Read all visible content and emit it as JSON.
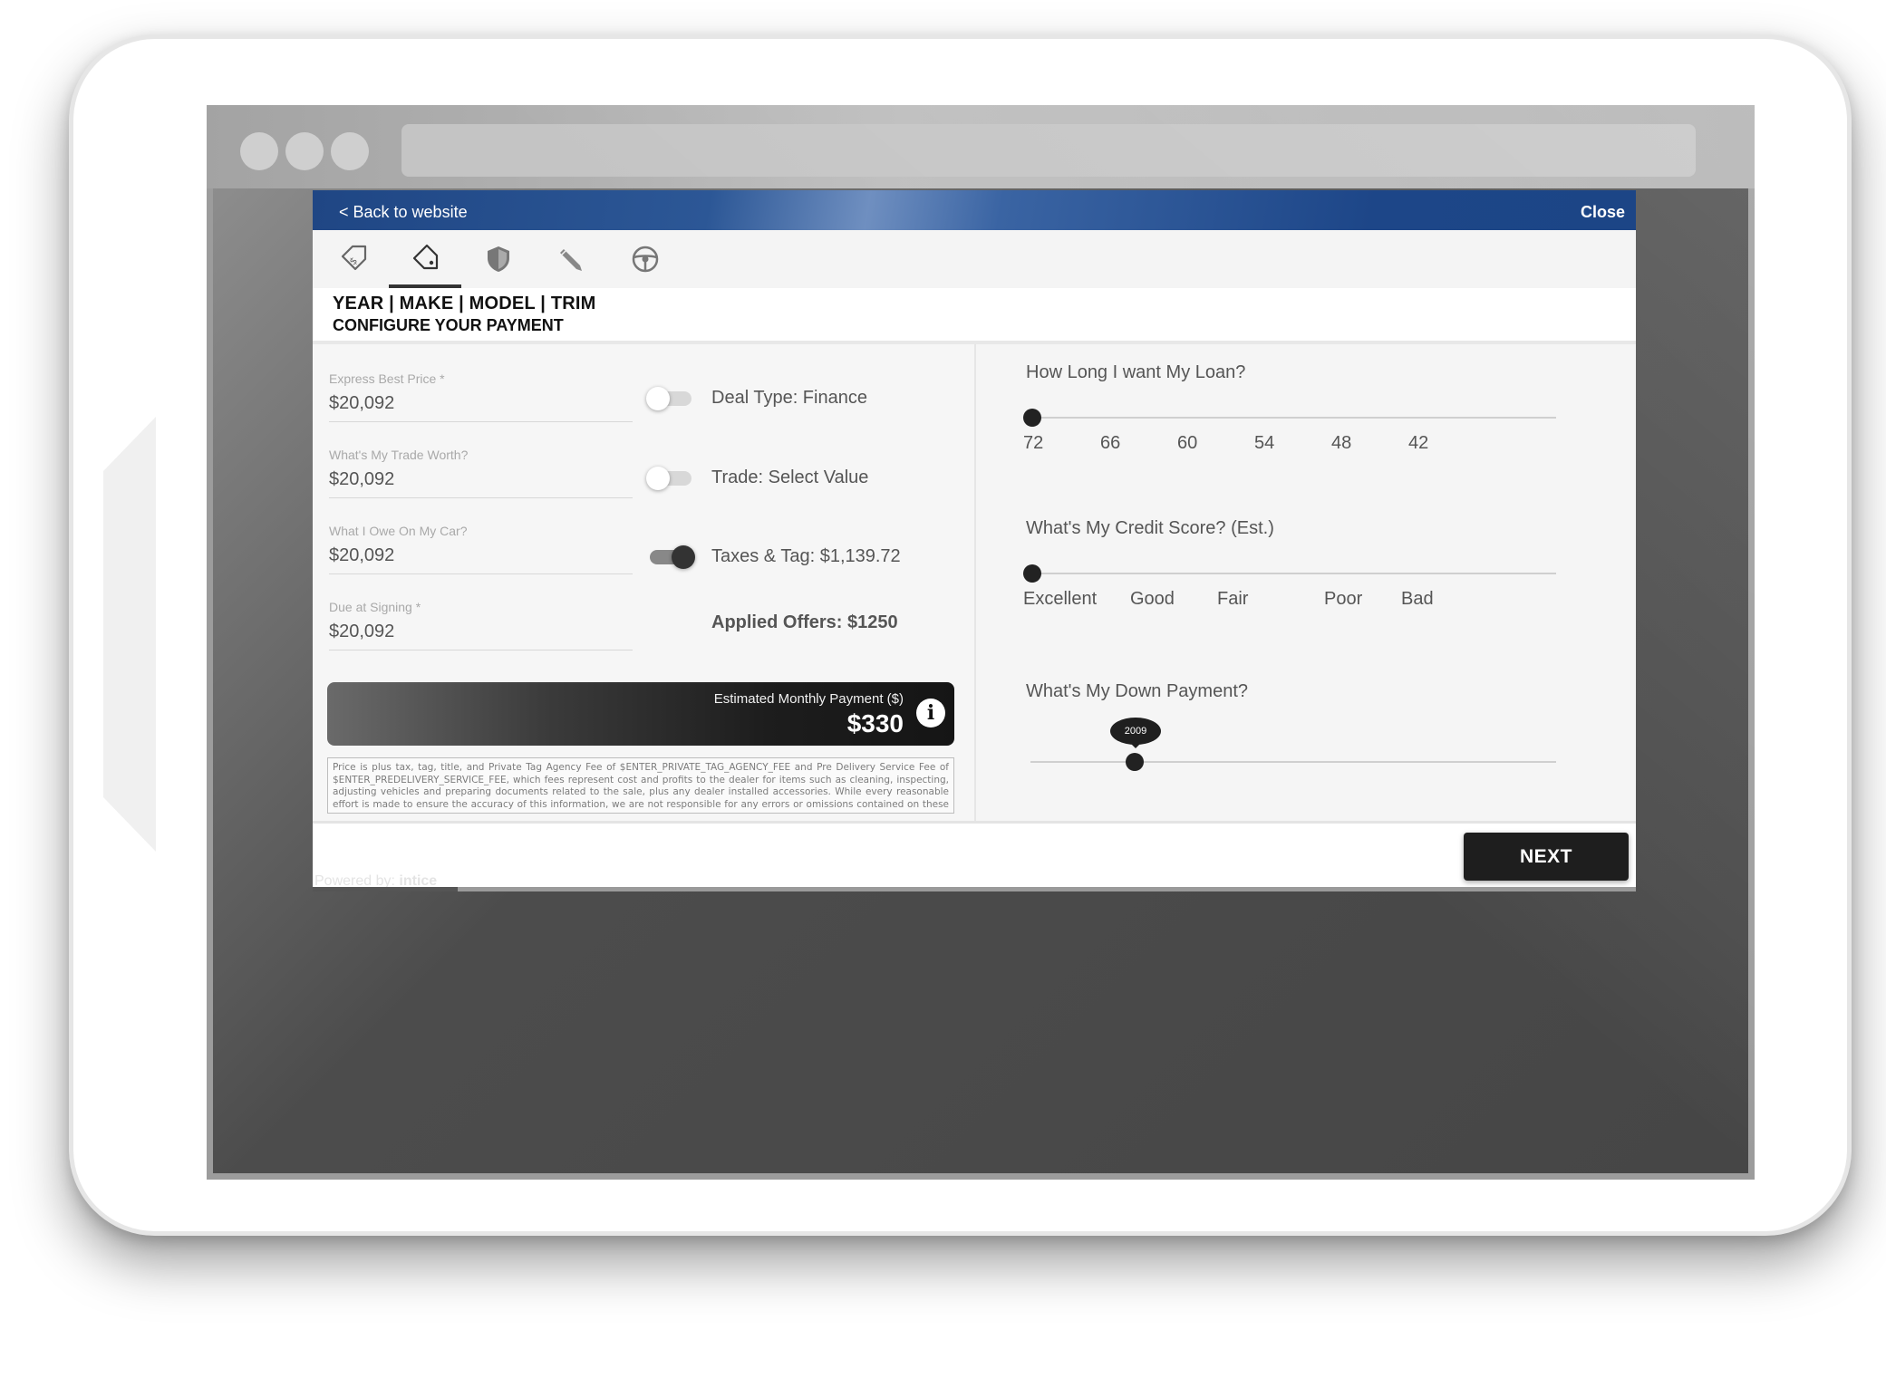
{
  "modal": {
    "back_label": "< Back to website",
    "close_label": "Close",
    "tabs": [
      {
        "icon": "price-tag-dollar-icon"
      },
      {
        "icon": "tag-icon",
        "active": true
      },
      {
        "icon": "shield-icon"
      },
      {
        "icon": "pen-icon"
      },
      {
        "icon": "steering-wheel-icon"
      }
    ],
    "title_line1": "YEAR | MAKE | MODEL | TRIM",
    "title_line2": "CONFIGURE YOUR PAYMENT"
  },
  "fields": [
    {
      "label": "Express Best Price *",
      "value": "$20,092"
    },
    {
      "label": "What's My Trade Worth?",
      "value": "$20,092"
    },
    {
      "label": "What I Owe On My Car?",
      "value": "$20,092"
    },
    {
      "label": "Due at Signing *",
      "value": "$20,092"
    }
  ],
  "toggles": [
    {
      "label": "Deal Type: Finance",
      "on": false
    },
    {
      "label": "Trade: Select Value",
      "on": false
    },
    {
      "label": "Taxes & Tag: $1,139.72",
      "on": true
    }
  ],
  "applied_offers": "Applied Offers: $1250",
  "payment": {
    "label": "Estimated Monthly Payment ($)",
    "value": "$330",
    "info_icon": "i"
  },
  "disclaimer": "Price is plus tax, tag, title, and Private Tag Agency Fee of $ENTER_PRIVATE_TAG_AGENCY_FEE and Pre Delivery Service Fee of $ENTER_PREDELIVERY_SERVICE_FEE, which fees represent cost and profits to the dealer for items such as cleaning, inspecting, adjusting vehicles and preparing documents related to the sale, plus any dealer installed accessories. While every reasonable effort is made to ensure the accuracy of this information, we are not responsible for any errors or omissions contained on these pages.",
  "loan": {
    "question": "How Long I want My Loan?",
    "ticks": [
      "72",
      "66",
      "60",
      "54",
      "48",
      "42"
    ],
    "selected": "72"
  },
  "credit": {
    "question": "What's My Credit Score? (Est.)",
    "ticks": [
      "Excellent",
      "Good",
      "Fair",
      "Poor",
      "Bad"
    ],
    "selected": "Excellent"
  },
  "down_payment": {
    "question": "What's My Down Payment?",
    "value": "2009"
  },
  "footer": {
    "powered_by": "Powered by:",
    "brand": "intice",
    "next_label": "NEXT"
  }
}
